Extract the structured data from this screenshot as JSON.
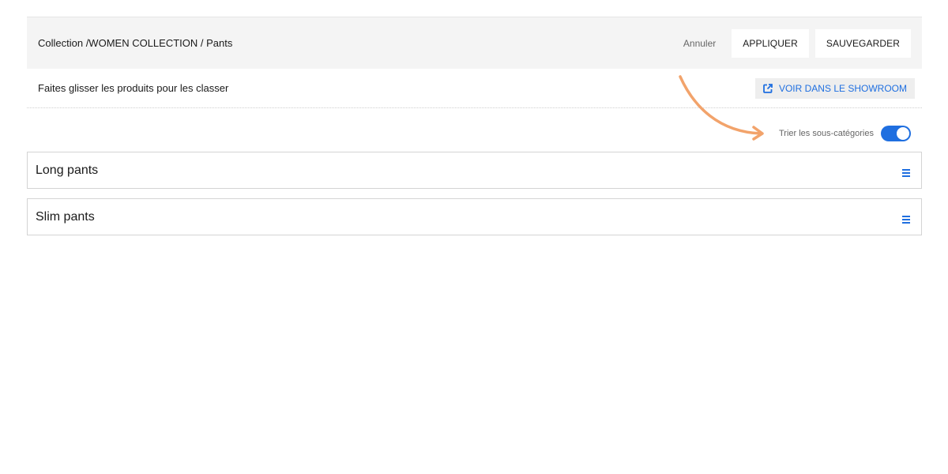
{
  "header": {
    "breadcrumb": "Collection /WOMEN COLLECTION / Pants",
    "cancel_label": "Annuler",
    "apply_label": "APPLIQUER",
    "save_label": "SAUVEGARDER"
  },
  "subbar": {
    "instruction": "Faites glisser les produits pour les classer",
    "showroom_label": "VOIR DANS LE SHOWROOM",
    "showroom_icon": "external-link-icon"
  },
  "sort": {
    "label": "Trier les sous-catégories",
    "toggle_on": true
  },
  "categories": [
    {
      "label": "Long pants",
      "icon": "drag-handle-icon"
    },
    {
      "label": "Slim pants",
      "icon": "drag-handle-icon"
    }
  ],
  "colors": {
    "accent": "#1f6fe0",
    "header_bg": "#f4f4f4",
    "annotation_arrow": "#f2a36b"
  }
}
